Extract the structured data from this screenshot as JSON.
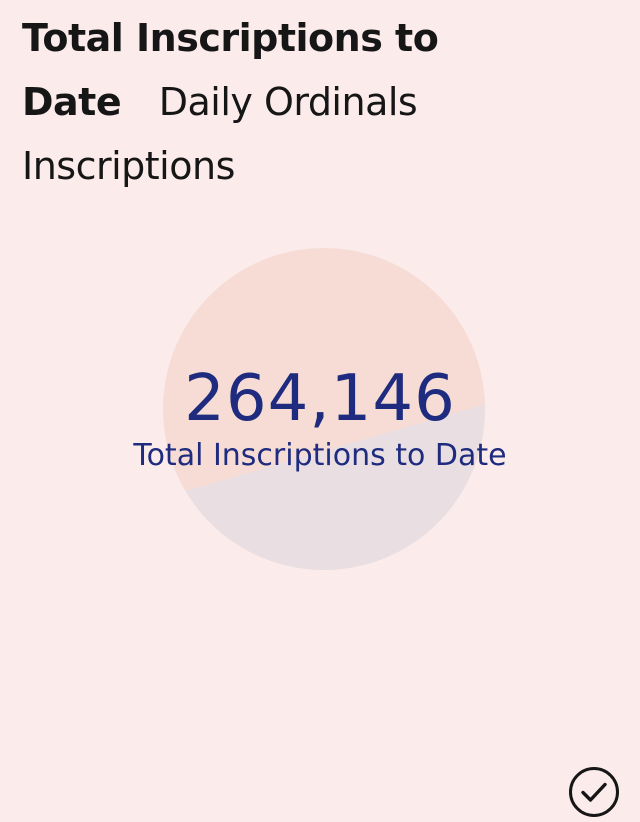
{
  "tabs": [
    {
      "label": "Total Inscriptions to Date",
      "active": true
    },
    {
      "label": "Daily Ordinals Inscriptions",
      "active": false
    }
  ],
  "summary": {
    "value": "264,146",
    "label": "Total Inscriptions to Date"
  },
  "colors": {
    "background": "#fbeceb",
    "accent": "#1e2b7e",
    "slice_primary": "#f6dcd5",
    "slice_secondary": "#e9dfe3"
  },
  "icons": {
    "confirm": "check-circle-icon"
  }
}
